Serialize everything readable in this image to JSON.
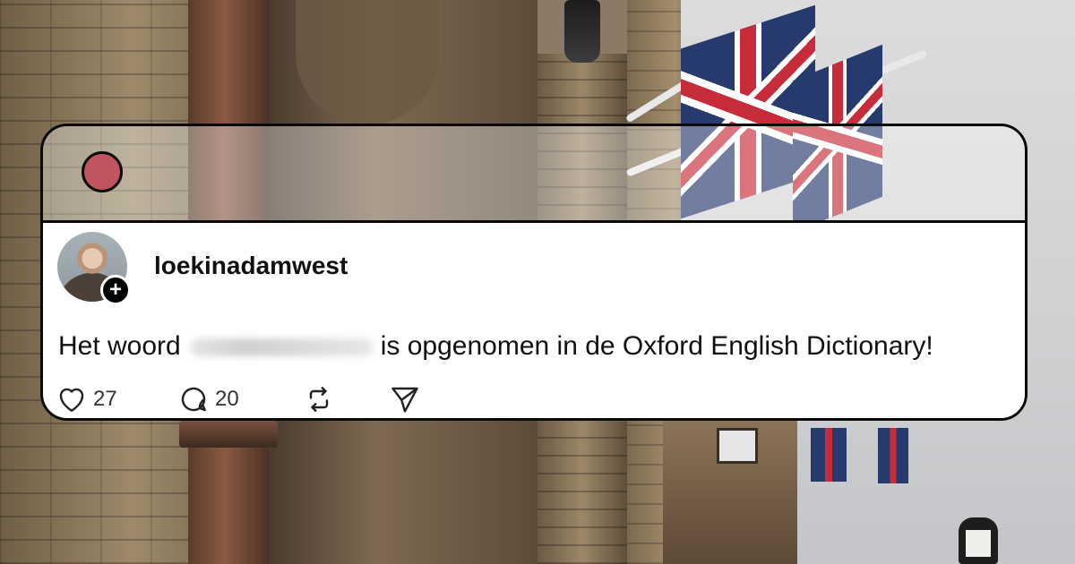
{
  "post": {
    "username": "loekinadamwest",
    "text_before": "Het woord",
    "text_after": "is opgenomen in de Oxford English Dictionary!",
    "likes": "27",
    "replies": "20"
  },
  "icons": {
    "follow": "plus-icon",
    "like": "heart-icon",
    "reply": "comment-icon",
    "repost": "repost-icon",
    "share": "send-icon"
  },
  "colors": {
    "titlebar_dot": "#c25462",
    "card_border": "#0a0a0a"
  }
}
